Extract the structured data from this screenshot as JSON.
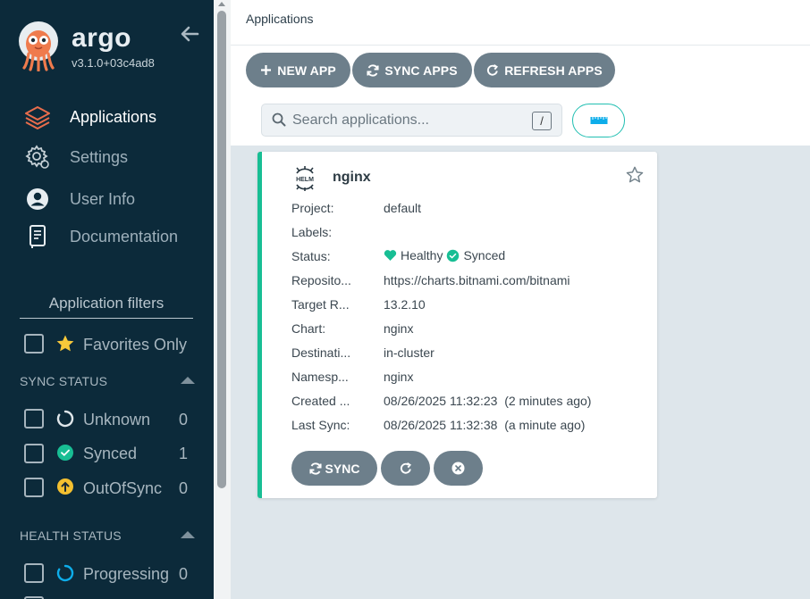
{
  "brand": {
    "name": "argo",
    "version": "v3.1.0+03c4ad8"
  },
  "nav": [
    {
      "label": "Applications",
      "icon": "stack-icon",
      "active": true
    },
    {
      "label": "Settings",
      "icon": "gear-icon",
      "active": false
    },
    {
      "label": "User Info",
      "icon": "user-icon",
      "active": false
    },
    {
      "label": "Documentation",
      "icon": "book-icon",
      "active": false
    }
  ],
  "filters": {
    "title": "Application filters",
    "favorites_label": "Favorites Only",
    "sync_status": {
      "title": "SYNC STATUS",
      "items": [
        {
          "label": "Unknown",
          "count": "0",
          "icon": "circle-notch-icon"
        },
        {
          "label": "Synced",
          "count": "1",
          "icon": "check-circle-icon"
        },
        {
          "label": "OutOfSync",
          "count": "0",
          "icon": "arrow-up-circle-icon"
        }
      ]
    },
    "health_status": {
      "title": "HEALTH STATUS",
      "items": [
        {
          "label": "Progressing",
          "count": "0",
          "icon": "circle-progress-icon"
        }
      ]
    }
  },
  "header": {
    "breadcrumb": "Applications"
  },
  "toolbar": {
    "new_app": "NEW APP",
    "sync_apps": "SYNC APPS",
    "refresh_apps": "REFRESH APPS"
  },
  "search": {
    "placeholder": "Search applications...",
    "shortcut": "/"
  },
  "app": {
    "name": "nginx",
    "icon_text": "HELM",
    "fields": [
      {
        "key": "Project:",
        "value": "default"
      },
      {
        "key": "Labels:",
        "value": ""
      },
      {
        "key": "Status:",
        "value": ""
      },
      {
        "key": "Reposito...",
        "value": "https://charts.bitnami.com/bitnami"
      },
      {
        "key": "Target R...",
        "value": "13.2.10"
      },
      {
        "key": "Chart:",
        "value": "nginx"
      },
      {
        "key": "Destinati...",
        "value": "in-cluster"
      },
      {
        "key": "Namesp...",
        "value": "nginx"
      },
      {
        "key": "Created ...",
        "value": "08/26/2025 11:32:23  (2 minutes ago)"
      },
      {
        "key": "Last Sync:",
        "value": "08/26/2025 11:32:38  (a minute ago)"
      }
    ],
    "health": "Healthy",
    "sync": "Synced",
    "sync_button": "SYNC"
  },
  "colors": {
    "sidebar_bg": "#0c2a3a",
    "accent_orange": "#e96d4c",
    "healthy_green": "#18be94",
    "outofsync_yellow": "#f4c030",
    "unknown_blue": "#0dadea",
    "button_gray": "#6d7f8b"
  }
}
